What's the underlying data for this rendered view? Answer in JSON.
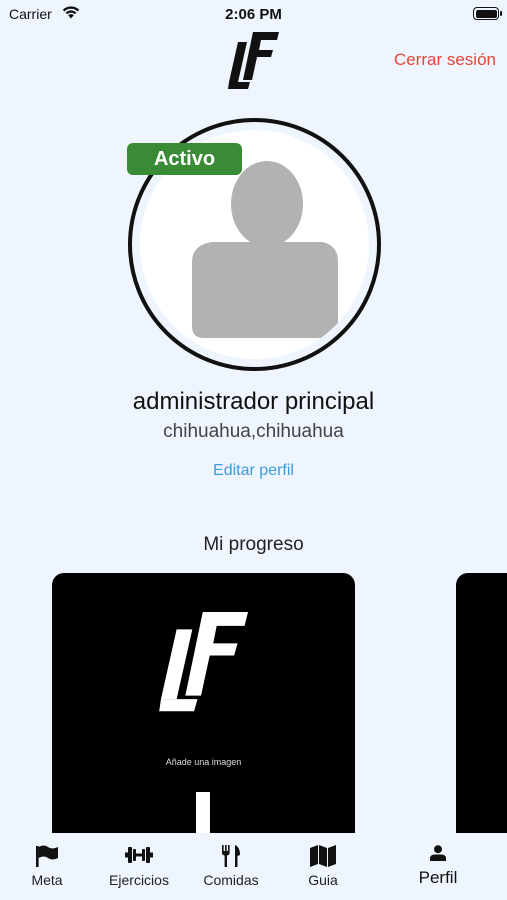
{
  "status_bar": {
    "carrier": "Carrier",
    "time": "2:06 PM"
  },
  "header": {
    "logo_text": "LF",
    "logout_label": "Cerrar sesión",
    "logout_color": "#e5483a"
  },
  "profile": {
    "status_badge": "Activo",
    "status_color": "#3a8b35",
    "name": "administrador principal",
    "location": "chihuahua,chihuahua",
    "edit_label": "Editar perfil"
  },
  "progress": {
    "title": "Mi progreso",
    "cards": [
      {
        "logo_text": "LF",
        "caption": "Añade una imagen"
      }
    ]
  },
  "tab_bar": {
    "items": [
      {
        "label": "Meta",
        "icon": "flag-icon"
      },
      {
        "label": "Ejercicios",
        "icon": "dumbbell-icon"
      },
      {
        "label": "Comidas",
        "icon": "utensils-icon"
      },
      {
        "label": "Guia",
        "icon": "map-icon"
      },
      {
        "label": "Perfil",
        "icon": "person-icon",
        "active": true
      }
    ]
  }
}
